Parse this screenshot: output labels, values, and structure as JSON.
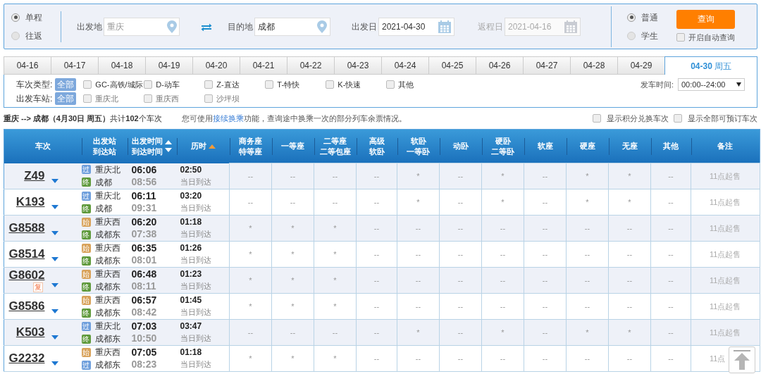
{
  "search": {
    "trip_types": [
      {
        "label": "单程",
        "selected": true
      },
      {
        "label": "往返",
        "selected": false
      }
    ],
    "from": {
      "label": "出发地",
      "placeholder": "重庆"
    },
    "to": {
      "label": "目的地",
      "value": "成都"
    },
    "depart_date": {
      "label": "出发日",
      "value": "2021-04-30",
      "disabled": false
    },
    "return_date": {
      "label": "返程日",
      "value": "2021-04-16",
      "disabled": true
    },
    "passenger_types": [
      {
        "label": "普通",
        "selected": true
      },
      {
        "label": "学生",
        "selected": false
      }
    ],
    "query_button": "查询",
    "auto_query": {
      "label": "开启自动查询",
      "checked": false
    }
  },
  "date_tabs": [
    {
      "label": "04-16",
      "selected": false
    },
    {
      "label": "04-17",
      "selected": false
    },
    {
      "label": "04-18",
      "selected": false
    },
    {
      "label": "04-19",
      "selected": false
    },
    {
      "label": "04-20",
      "selected": false
    },
    {
      "label": "04-21",
      "selected": false
    },
    {
      "label": "04-22",
      "selected": false
    },
    {
      "label": "04-23",
      "selected": false
    },
    {
      "label": "04-24",
      "selected": false
    },
    {
      "label": "04-25",
      "selected": false
    },
    {
      "label": "04-26",
      "selected": false
    },
    {
      "label": "04-27",
      "selected": false
    },
    {
      "label": "04-28",
      "selected": false
    },
    {
      "label": "04-29",
      "selected": false
    },
    {
      "label": "04-30",
      "weekday": "周五",
      "selected": true
    }
  ],
  "filters": {
    "train_type": {
      "label": "车次类型:",
      "all": {
        "label": "全部",
        "selected": true
      },
      "options": [
        {
          "label": "GC-高铁/城际",
          "checked": false
        },
        {
          "label": "D-动车",
          "checked": false
        },
        {
          "label": "Z-直达",
          "checked": false
        },
        {
          "label": "T-特快",
          "checked": false
        },
        {
          "label": "K-快速",
          "checked": false
        },
        {
          "label": "其他",
          "checked": false
        }
      ]
    },
    "station": {
      "label": "出发车站:",
      "all": {
        "label": "全部",
        "selected": true
      },
      "options": [
        {
          "label": "重庆北",
          "checked": false
        },
        {
          "label": "重庆西",
          "checked": false
        },
        {
          "label": "沙坪坝",
          "checked": false
        }
      ]
    },
    "time": {
      "label": "发车时间:",
      "value": "00:00--24:00"
    }
  },
  "summary": {
    "text": "**重庆 --> 成都（4月30日  周五）**共计**102**个车次",
    "notice_before": "您可使用",
    "notice_link": "接续换乘",
    "notice_after": "功能，查询途中换乘一次的部分列车余票情况。",
    "toggles": [
      {
        "label": "显示积分兑换车次",
        "checked": false
      },
      {
        "label": "显示全部可预订车次",
        "checked": false
      }
    ]
  },
  "table": {
    "columns": [
      {
        "lines": [
          "车次"
        ]
      },
      {
        "lines": [
          "出发站",
          "到达站"
        ]
      },
      {
        "lines": [
          "出发时间",
          "到达时间"
        ],
        "sort_up": true,
        "sort_down": true,
        "sort_active": false
      },
      {
        "lines": [
          "历时"
        ],
        "sort_up": true,
        "sort_active": true
      },
      {
        "lines": [
          "商务座",
          "特等座"
        ]
      },
      {
        "lines": [
          "一等座"
        ]
      },
      {
        "lines": [
          "二等座",
          "二等包座"
        ]
      },
      {
        "lines": [
          "高级",
          "软卧"
        ]
      },
      {
        "lines": [
          "软卧",
          "一等卧"
        ]
      },
      {
        "lines": [
          "动卧"
        ]
      },
      {
        "lines": [
          "硬卧",
          "二等卧"
        ]
      },
      {
        "lines": [
          "软座"
        ]
      },
      {
        "lines": [
          "硬座"
        ]
      },
      {
        "lines": [
          "无座"
        ]
      },
      {
        "lines": [
          "其他"
        ]
      },
      {
        "lines": [
          "备注"
        ]
      }
    ],
    "rows": [
      {
        "train": "Z49",
        "from": {
          "kind": "pass",
          "tag": "过",
          "name": "重庆北"
        },
        "to": {
          "kind": "end",
          "tag": "终",
          "name": "成都"
        },
        "depart": "06:06",
        "arrive": "08:56",
        "duration": "02:50",
        "arrival_day": "当日到达",
        "seats": [
          "--",
          "--",
          "--",
          "--",
          "*",
          "--",
          "*",
          "--",
          "*",
          "*",
          "--"
        ],
        "remark": "11点起售"
      },
      {
        "train": "K193",
        "from": {
          "kind": "pass",
          "tag": "过",
          "name": "重庆北"
        },
        "to": {
          "kind": "end",
          "tag": "终",
          "name": "成都"
        },
        "depart": "06:11",
        "arrive": "09:31",
        "duration": "03:20",
        "arrival_day": "当日到达",
        "seats": [
          "--",
          "--",
          "--",
          "--",
          "*",
          "--",
          "*",
          "--",
          "*",
          "*",
          "--"
        ],
        "remark": "11点起售"
      },
      {
        "train": "G8588",
        "from": {
          "kind": "start",
          "tag": "始",
          "name": "重庆西"
        },
        "to": {
          "kind": "end",
          "tag": "终",
          "name": "成都东"
        },
        "depart": "06:20",
        "arrive": "07:38",
        "duration": "01:18",
        "arrival_day": "当日到达",
        "seats": [
          "*",
          "*",
          "*",
          "--",
          "--",
          "--",
          "--",
          "--",
          "--",
          "--",
          "--"
        ],
        "remark": "11点起售"
      },
      {
        "train": "G8514",
        "from": {
          "kind": "start",
          "tag": "始",
          "name": "重庆西"
        },
        "to": {
          "kind": "end",
          "tag": "终",
          "name": "成都东"
        },
        "depart": "06:35",
        "arrive": "08:01",
        "duration": "01:26",
        "arrival_day": "当日到达",
        "seats": [
          "*",
          "*",
          "*",
          "--",
          "--",
          "--",
          "--",
          "--",
          "--",
          "--",
          "--"
        ],
        "remark": "11点起售"
      },
      {
        "train": "G8602",
        "badge": "复",
        "from": {
          "kind": "start",
          "tag": "始",
          "name": "重庆西"
        },
        "to": {
          "kind": "end",
          "tag": "终",
          "name": "成都东"
        },
        "depart": "06:48",
        "arrive": "08:11",
        "duration": "01:23",
        "arrival_day": "当日到达",
        "seats": [
          "*",
          "*",
          "*",
          "--",
          "--",
          "--",
          "--",
          "--",
          "--",
          "--",
          "--"
        ],
        "remark": "11点起售"
      },
      {
        "train": "G8586",
        "from": {
          "kind": "start",
          "tag": "始",
          "name": "重庆西"
        },
        "to": {
          "kind": "end",
          "tag": "终",
          "name": "成都东"
        },
        "depart": "06:57",
        "arrive": "08:42",
        "duration": "01:45",
        "arrival_day": "当日到达",
        "seats": [
          "*",
          "*",
          "*",
          "--",
          "--",
          "--",
          "--",
          "--",
          "--",
          "--",
          "--"
        ],
        "remark": "11点起售"
      },
      {
        "train": "K503",
        "from": {
          "kind": "pass",
          "tag": "过",
          "name": "重庆北"
        },
        "to": {
          "kind": "end",
          "tag": "终",
          "name": "成都东"
        },
        "depart": "07:03",
        "arrive": "10:50",
        "duration": "03:47",
        "arrival_day": "当日到达",
        "seats": [
          "--",
          "--",
          "--",
          "--",
          "*",
          "--",
          "*",
          "--",
          "*",
          "*",
          "--"
        ],
        "remark": "11点起售"
      },
      {
        "train": "G2232",
        "from": {
          "kind": "start",
          "tag": "始",
          "name": "重庆西"
        },
        "to": {
          "kind": "pass",
          "tag": "过",
          "name": "成都东"
        },
        "depart": "07:05",
        "arrive": "08:23",
        "duration": "01:18",
        "arrival_day": "当日到达",
        "seats": [
          "*",
          "*",
          "*",
          "--",
          "--",
          "--",
          "--",
          "--",
          "--",
          "--",
          "--"
        ],
        "remark": "11点"
      }
    ]
  }
}
